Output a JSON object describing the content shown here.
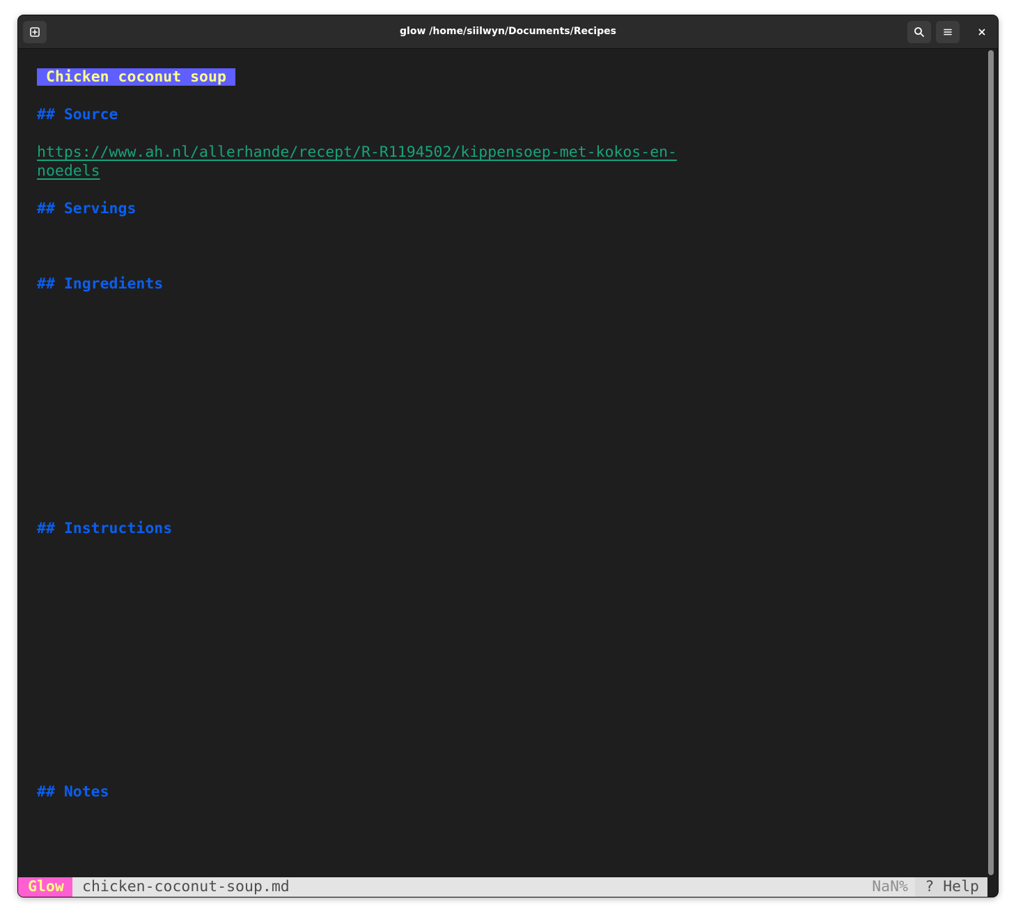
{
  "window": {
    "title": "glow /home/siilwyn/Documents/Recipes"
  },
  "document": {
    "h1": "Chicken coconut soup",
    "source_heading": "## Source",
    "source_link_line1": "https://www.ah.nl/allerhande/recept/R-R1194502/kippensoep-met-kokos-en-",
    "source_link_line2": "noedels",
    "servings_heading": "## Servings",
    "ingredients_heading": "## Ingredients",
    "instructions_heading": "## Instructions",
    "notes_heading": "## Notes"
  },
  "statusbar": {
    "app": "Glow",
    "filename": "chicken-coconut-soup.md",
    "percent": "NaN%",
    "help": "? Help"
  },
  "icons": {
    "new_tab": "new-tab-icon",
    "search": "search-icon",
    "menu": "hamburger-menu-icon",
    "close": "close-icon"
  },
  "colors": {
    "background": "#1e1e1e",
    "h1_bg": "#5f5fff",
    "h1_fg": "#ffff87",
    "heading": "#0a5ff0",
    "link": "#17a37b",
    "status_app_bg": "#ff5fd2"
  }
}
